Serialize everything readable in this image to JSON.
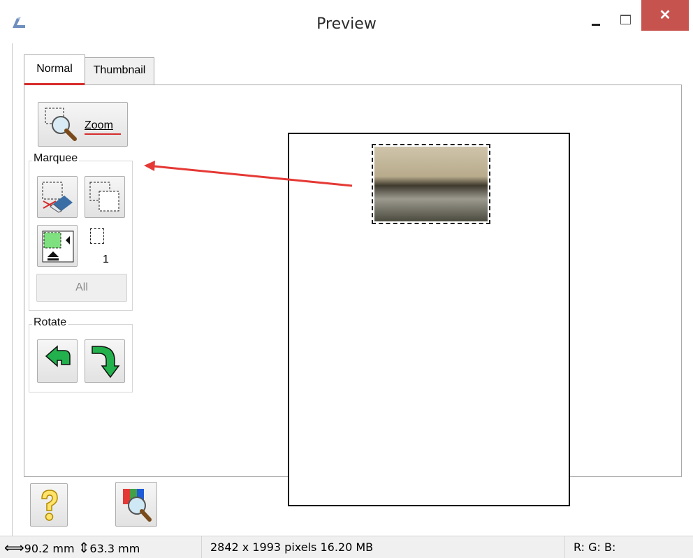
{
  "window": {
    "title": "Preview",
    "close_glyph": "✕"
  },
  "tabs": [
    {
      "label": "Normal",
      "selected": true
    },
    {
      "label": "Thumbnail",
      "selected": false
    }
  ],
  "tools": {
    "zoom_label": "Zoom",
    "marquee_group_label": "Marquee",
    "marquee_count": "1",
    "all_label": "All",
    "rotate_group_label": "Rotate"
  },
  "statusbar": {
    "width_glyph": "⟺",
    "width_value": "90.2 mm",
    "height_glyph": "⇕",
    "height_value": "63.3 mm",
    "pixels": "2842 x 1993 pixels 16.20 MB",
    "rgb": "R: G: B:"
  },
  "colors": {
    "accent_red": "#d72b2b",
    "close_button": "#c7534f",
    "rotate_arrow_green": "#22b14c"
  },
  "icons": [
    "app-icon",
    "zoom-magnifier-icon",
    "erase-marquee-icon",
    "duplicate-marquee-icon",
    "auto-locate-icon",
    "rotate-left-icon",
    "rotate-right-icon",
    "help-icon",
    "color-palette-icon"
  ]
}
